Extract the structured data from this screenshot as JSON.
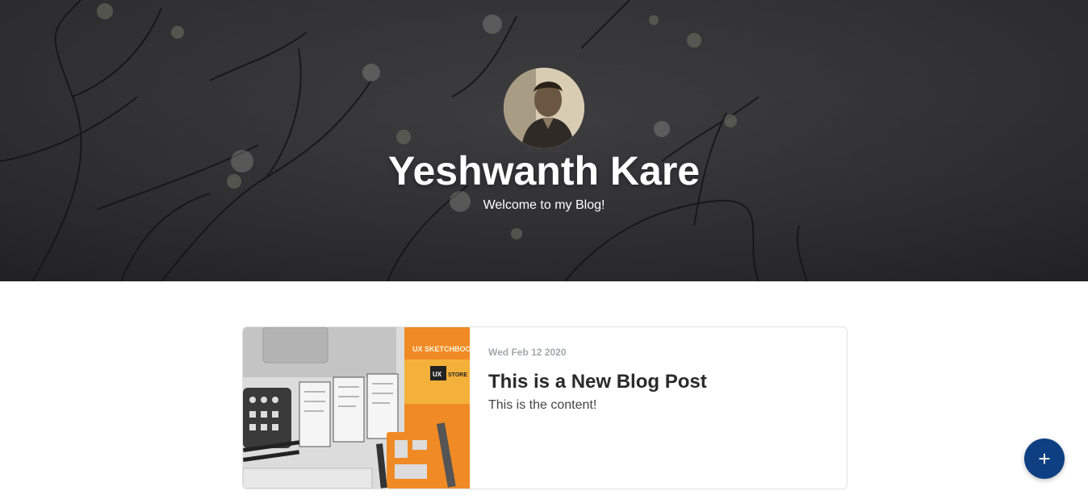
{
  "hero": {
    "name": "Yeshwanth Kare",
    "subtitle": "Welcome to my Blog!"
  },
  "posts": [
    {
      "date": "Wed Feb 12 2020",
      "title": "This is a New Blog Post",
      "content": "This is the content!",
      "image_text": {
        "sketchbook_label": "UX SKETCHBOOK",
        "logo_ux": "UX",
        "logo_store": "STORE"
      }
    }
  ],
  "fab": {
    "icon": "plus-icon",
    "label": "+"
  },
  "colors": {
    "fab_background": "#0d3f82",
    "hero_overlay": "#2e2e31",
    "date_text": "#a2a7ad",
    "title_text": "#2a2a2a"
  }
}
